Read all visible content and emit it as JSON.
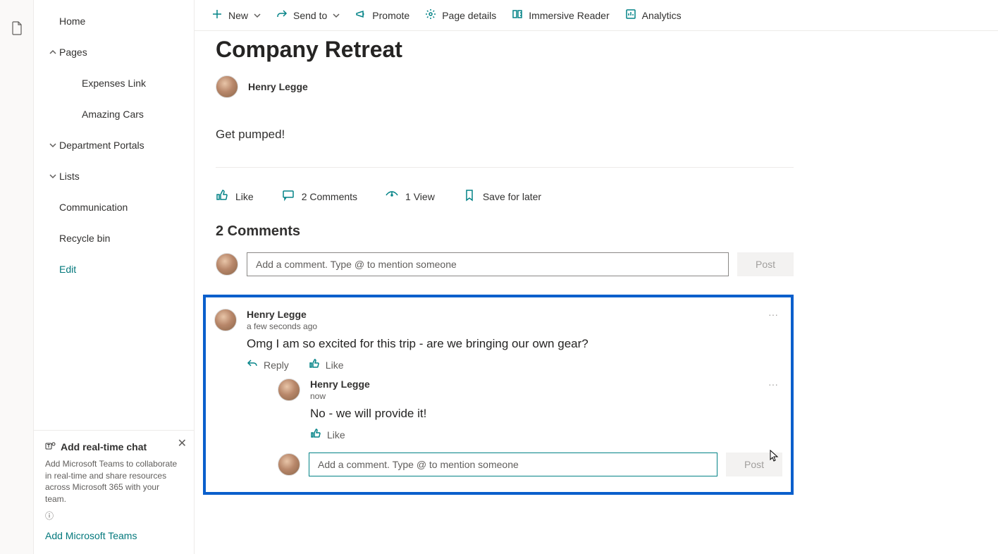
{
  "sidebar": {
    "items": [
      {
        "label": "Home",
        "hasChevron": false,
        "child": false
      },
      {
        "label": "Pages",
        "hasChevron": "up",
        "child": false
      },
      {
        "label": "Expenses Link",
        "hasChevron": false,
        "child": true
      },
      {
        "label": "Amazing Cars",
        "hasChevron": false,
        "child": true
      },
      {
        "label": "Department Portals",
        "hasChevron": "down",
        "child": false
      },
      {
        "label": "Lists",
        "hasChevron": "down",
        "child": false
      },
      {
        "label": "Communication",
        "hasChevron": false,
        "child": false
      },
      {
        "label": "Recycle bin",
        "hasChevron": false,
        "child": false
      }
    ],
    "edit": "Edit"
  },
  "promo": {
    "title": "Add real-time chat",
    "desc": "Add Microsoft Teams to collaborate in real-time and share resources across Microsoft 365 with your team.",
    "link": "Add Microsoft Teams"
  },
  "toolbar": {
    "new": "New",
    "send_to": "Send to",
    "promote": "Promote",
    "page_details": "Page details",
    "immersive": "Immersive Reader",
    "analytics": "Analytics"
  },
  "page": {
    "title": "Company Retreat",
    "author": "Henry Legge",
    "body": "Get pumped!"
  },
  "social": {
    "like": "Like",
    "comments": "2 Comments",
    "views": "1 View",
    "save": "Save for later"
  },
  "comments": {
    "header": "2 Comments",
    "placeholder": "Add a comment. Type @ to mention someone",
    "post": "Post",
    "list": [
      {
        "author": "Henry Legge",
        "time": "a few seconds ago",
        "text": "Omg I am so excited for this trip - are we bringing our own gear?",
        "reply_label": "Reply",
        "like_label": "Like",
        "replies": [
          {
            "author": "Henry Legge",
            "time": "now",
            "text": "No - we will provide it!",
            "like_label": "Like"
          }
        ]
      }
    ]
  }
}
